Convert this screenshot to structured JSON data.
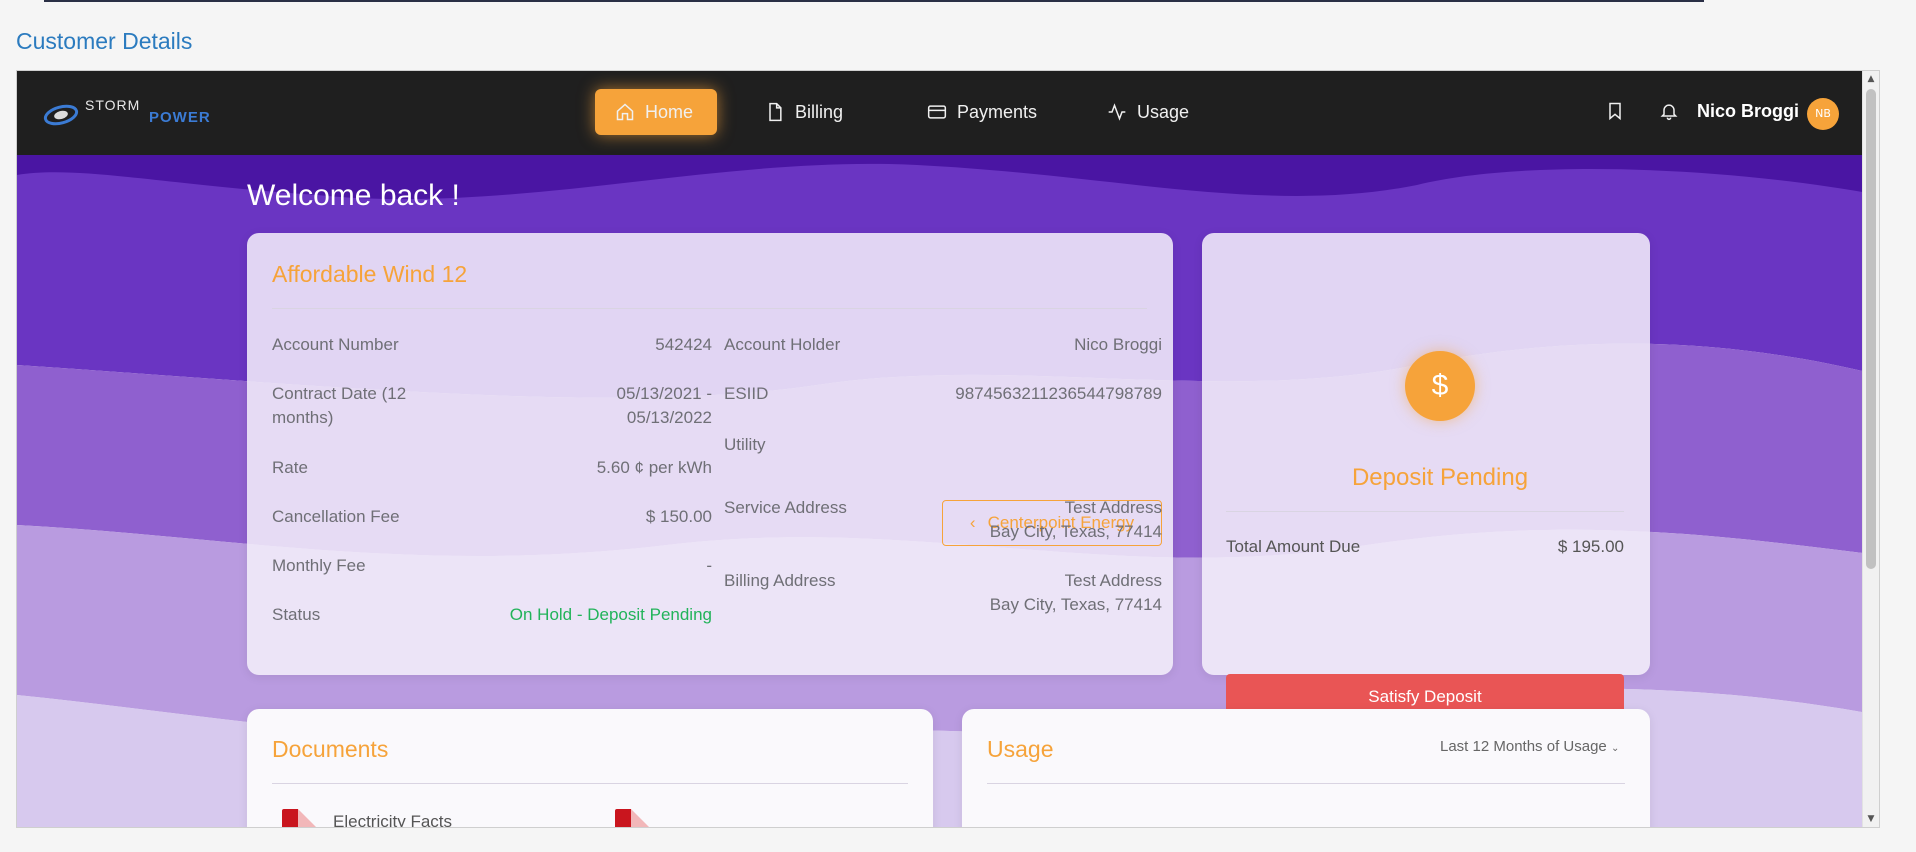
{
  "page": {
    "title": "Customer Details"
  },
  "brand": {
    "storm": "STORM",
    "power": "POWER"
  },
  "nav": {
    "items": [
      {
        "label": "Home",
        "icon": "home-icon",
        "active": true
      },
      {
        "label": "Billing",
        "icon": "file-icon",
        "active": false
      },
      {
        "label": "Payments",
        "icon": "credit-card-icon",
        "active": false
      },
      {
        "label": "Usage",
        "icon": "activity-icon",
        "active": false
      }
    ],
    "user_name": "Nico Broggi",
    "avatar_initials": "NB"
  },
  "welcome": "Welcome back !",
  "plan": {
    "title": "Affordable Wind 12",
    "left_fields": [
      {
        "label": "Account Number",
        "value": "542424"
      },
      {
        "label": "Contract Date (12 months)",
        "value": "05/13/2021 - 05/13/2022"
      },
      {
        "label": "Rate",
        "value": "5.60 ¢ per kWh"
      },
      {
        "label": "Cancellation Fee",
        "value": "$ 150.00"
      },
      {
        "label": "Monthly Fee",
        "value": "-"
      },
      {
        "label": "Status",
        "value": "On Hold - Deposit Pending"
      }
    ],
    "right_fields": {
      "account_holder_label": "Account Holder",
      "account_holder": "Nico Broggi",
      "esiid_label": "ESIID",
      "esiid": "9874563211236544798789",
      "utility_label": "Utility",
      "utility": "Centerpoint Energy",
      "service_address_label": "Service Address",
      "service_address_line1": "Test Address",
      "service_address_line2": "Bay City, Texas, 77414",
      "billing_address_label": "Billing Address",
      "billing_address_line1": "Test Address",
      "billing_address_line2": "Bay City, Texas, 77414"
    }
  },
  "deposit": {
    "icon_symbol": "$",
    "title": "Deposit Pending",
    "total_label": "Total Amount Due",
    "total_value": "$ 195.00",
    "button": "Satisfy Deposit"
  },
  "documents": {
    "title": "Documents",
    "first_item": "Electricity Facts"
  },
  "usage": {
    "title": "Usage",
    "range_select": "Last 12 Months of Usage"
  },
  "colors": {
    "accent": "#f6a33a",
    "danger": "#e95555",
    "success": "#22b35a",
    "navbar": "#1f1f1f",
    "hero_purple": "#5a22b0"
  }
}
